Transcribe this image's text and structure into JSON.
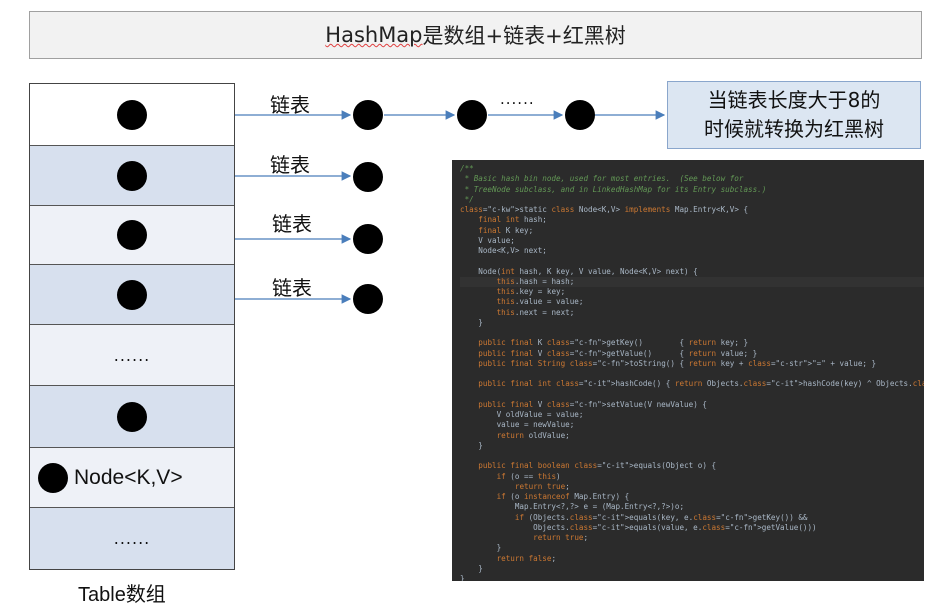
{
  "title": {
    "part1": "HashMap",
    "part2": " 是数组+链表+红黑树"
  },
  "table": {
    "label": "Table数组",
    "rows": [
      {
        "kind": "dot"
      },
      {
        "kind": "dot"
      },
      {
        "kind": "dot"
      },
      {
        "kind": "dot"
      },
      {
        "kind": "text",
        "text": "......"
      },
      {
        "kind": "dot"
      },
      {
        "kind": "node",
        "text": "Node<K,V>"
      },
      {
        "kind": "text",
        "text": "......"
      }
    ]
  },
  "chains": {
    "label1": "链表",
    "label2": "链表",
    "label3": "链表",
    "label4": "链表",
    "ellipsis": "......"
  },
  "note": {
    "line1": "当链表长度大于8的",
    "line2": "时候就转换为红黑树"
  },
  "code_lines": [
    "/**",
    " * Basic hash bin node, used for most entries.  (See below for",
    " * TreeNode subclass, and in LinkedHashMap for its Entry subclass.)",
    " */",
    "static class Node<K,V> implements Map.Entry<K,V> {",
    "    final int hash;",
    "    final K key;",
    "    V value;",
    "    Node<K,V> next;",
    "",
    "    Node(int hash, K key, V value, Node<K,V> next) {",
    "        this.hash = hash;",
    "        this.key = key;",
    "        this.value = value;",
    "        this.next = next;",
    "    }",
    "",
    "    public final K getKey()        { return key; }",
    "    public final V getValue()      { return value; }",
    "    public final String toString() { return key + \"=\" + value; }",
    "",
    "    public final int hashCode() { return Objects.hashCode(key) ^ Objects.hashCode(value); }",
    "",
    "    public final V setValue(V newValue) {",
    "        V oldValue = value;",
    "        value = newValue;",
    "        return oldValue;",
    "    }",
    "",
    "    public final boolean equals(Object o) {",
    "        if (o == this)",
    "            return true;",
    "        if (o instanceof Map.Entry) {",
    "            Map.Entry<?,?> e = (Map.Entry<?,?>)o;",
    "            if (Objects.equals(key, e.getKey()) &&",
    "                Objects.equals(value, e.getValue()))",
    "                return true;",
    "        }",
    "        return false;",
    "    }",
    "}"
  ],
  "colors": {
    "arrow": "#4a7ebb",
    "note_bg": "#dce6f2",
    "code_bg": "#2b2b2b",
    "row_blue": "#d7e0ee"
  }
}
